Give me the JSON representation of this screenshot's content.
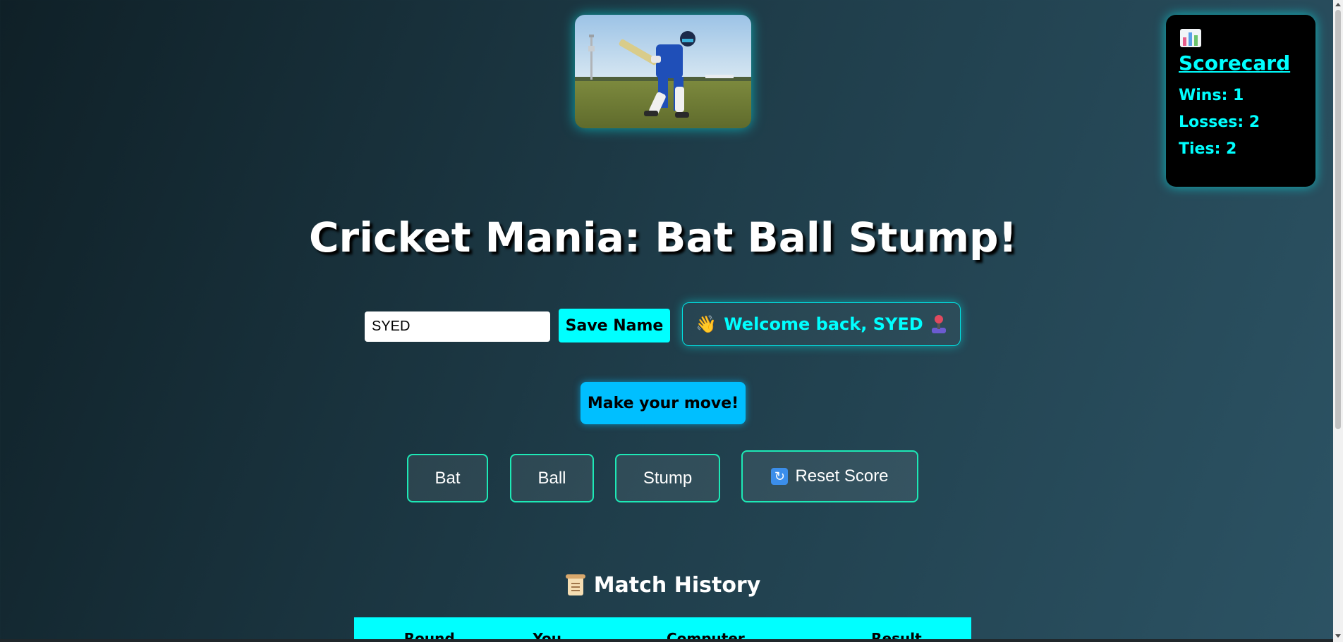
{
  "hero": {
    "image_icon": "batsman-photo"
  },
  "scorecard": {
    "icon": "bar-chart-icon",
    "title": "Scorecard",
    "wins_text": "Wins: 1",
    "losses_text": "Losses: 2",
    "ties_text": "Ties: 2"
  },
  "page": {
    "title": "Cricket Mania: Bat Ball Stump!"
  },
  "name_form": {
    "input_value": "SYED",
    "save_label": "Save Name",
    "welcome_emoji": "👋",
    "welcome_text": "Welcome back, SYED",
    "welcome_icon": "joystick-icon"
  },
  "game": {
    "prompt_label": "Make your move!",
    "choices": {
      "bat": "Bat",
      "ball": "Ball",
      "stump": "Stump"
    },
    "reset_icon": "reset-icon",
    "reset_label": "Reset Score"
  },
  "history": {
    "icon": "scroll-icon",
    "heading": "Match History",
    "columns": [
      "Round",
      "You",
      "Computer",
      "Result"
    ]
  },
  "colors": {
    "accent": "#00ffff",
    "button_blue": "#00bfff",
    "choice_border": "#1de9b6",
    "bg_start": "#0f2027",
    "bg_end": "#2c5364"
  }
}
